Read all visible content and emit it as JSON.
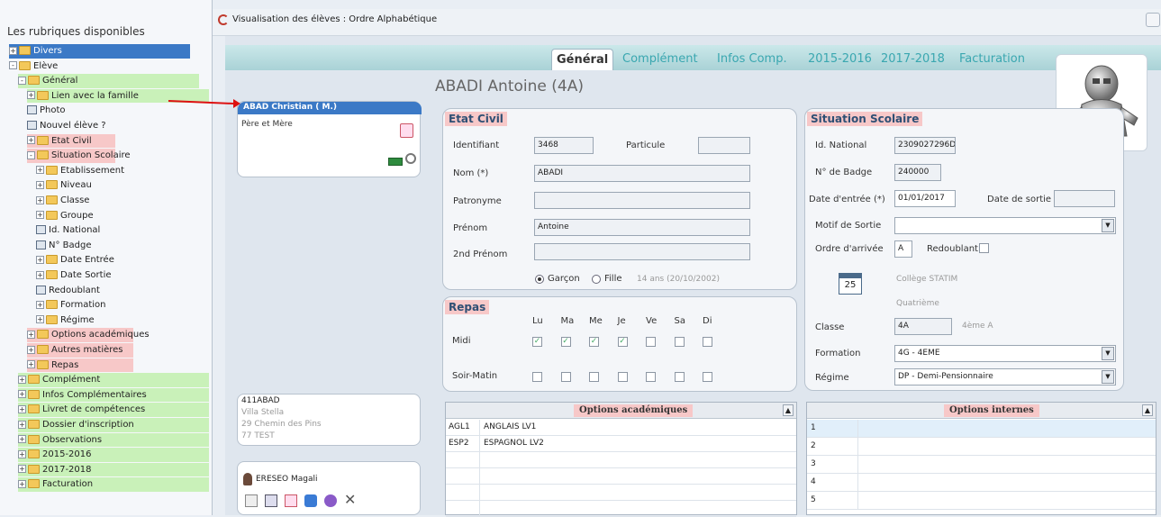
{
  "window": {
    "title": "Visualisation des élèves : Ordre Alphabétique"
  },
  "tree": {
    "header": "Les rubriques disponibles",
    "items": [
      {
        "label": "Divers",
        "exp": "+"
      },
      {
        "label": "Elève",
        "exp": "-"
      },
      {
        "label": "Général",
        "exp": "-"
      },
      {
        "label": "Lien avec la famille",
        "exp": "+"
      },
      {
        "label": "Photo",
        "exp": ""
      },
      {
        "label": "Nouvel élève ?",
        "exp": ""
      },
      {
        "label": "Etat Civil",
        "exp": "+"
      },
      {
        "label": "Situation Scolaire",
        "exp": "-"
      },
      {
        "label": "Etablissement",
        "exp": "+"
      },
      {
        "label": "Niveau",
        "exp": "+"
      },
      {
        "label": "Classe",
        "exp": "+"
      },
      {
        "label": "Groupe",
        "exp": "+"
      },
      {
        "label": "Id. National",
        "exp": ""
      },
      {
        "label": "N° Badge",
        "exp": ""
      },
      {
        "label": "Date Entrée",
        "exp": "+"
      },
      {
        "label": "Date Sortie",
        "exp": "+"
      },
      {
        "label": "Redoublant",
        "exp": ""
      },
      {
        "label": "Formation",
        "exp": "+"
      },
      {
        "label": "Régime",
        "exp": "+"
      },
      {
        "label": "Options académiques",
        "exp": "+"
      },
      {
        "label": "Autres matières",
        "exp": "+"
      },
      {
        "label": "Repas",
        "exp": "+"
      },
      {
        "label": "Complément",
        "exp": "+"
      },
      {
        "label": "Infos Complémentaires",
        "exp": "+"
      },
      {
        "label": "Livret de compétences",
        "exp": "+"
      },
      {
        "label": "Dossier d'inscription",
        "exp": "+"
      },
      {
        "label": "Observations",
        "exp": "+"
      },
      {
        "label": "2015-2016",
        "exp": "+"
      },
      {
        "label": "2017-2018",
        "exp": "+"
      },
      {
        "label": "Facturation",
        "exp": "+"
      }
    ]
  },
  "tabs": [
    "Général",
    "Complément",
    "Infos Comp.",
    "2015-2016",
    "2017-2018",
    "Facturation"
  ],
  "student": {
    "heading": "ABADI Antoine (4A)"
  },
  "family_card": {
    "title": "ABAD Christian  ( M.)",
    "relation": "Père et Mère"
  },
  "address_card": {
    "code": "411ABAD",
    "line1": "Villa Stella",
    "line2": "29 Chemin des Pins",
    "line3": "77 TEST"
  },
  "contact_card": {
    "name": "ERESEO Magali"
  },
  "etat_civil": {
    "title": "Etat Civil",
    "identifiant_label": "Identifiant",
    "identifiant": "3468",
    "particule_label": "Particule",
    "particule": "",
    "nom_label": "Nom (*)",
    "nom": "ABADI",
    "patronyme_label": "Patronyme",
    "patronyme": "",
    "prenom_label": "Prénom",
    "prenom": "Antoine",
    "prenom2_label": "2nd Prénom",
    "prenom2": "",
    "garcon": "Garçon",
    "fille": "Fille",
    "age": "14 ans (20/10/2002)"
  },
  "situation": {
    "title": "Situation Scolaire",
    "idnat_label": "Id. National",
    "idnat": "2309027296D",
    "badge_label": "N° de Badge",
    "badge": "240000",
    "entree_label": "Date d'entrée (*)",
    "entree": "01/01/2017",
    "sortie_label": "Date de sortie",
    "sortie": "",
    "motif_label": "Motif de Sortie",
    "motif": "",
    "ordre_label": "Ordre d'arrivée",
    "ordre": "A",
    "redoublant_label": "Redoublant",
    "etablissement": "Collège STATIM",
    "niveau": "Quatrième",
    "calendar_day": "25",
    "classe_label": "Classe",
    "classe": "4A",
    "classe_desc": "4ème A",
    "formation_label": "Formation",
    "formation": "4G - 4EME",
    "regime_label": "Régime",
    "regime": "DP - Demi-Pensionnaire"
  },
  "repas": {
    "title": "Repas",
    "days": [
      "Lu",
      "Ma",
      "Me",
      "Je",
      "Ve",
      "Sa",
      "Di"
    ],
    "rows": [
      {
        "label": "Midi",
        "checked": [
          true,
          true,
          true,
          true,
          false,
          false,
          false
        ]
      },
      {
        "label": "Soir-Matin",
        "checked": [
          false,
          false,
          false,
          false,
          false,
          false,
          false
        ]
      }
    ]
  },
  "options_academiques": {
    "title": "Options académiques",
    "rows": [
      [
        "AGL1",
        "ANGLAIS LV1"
      ],
      [
        "ESP2",
        "ESPAGNOL LV2"
      ]
    ]
  },
  "options_internes": {
    "title": "Options internes",
    "rows": [
      "1",
      "2",
      "3",
      "4",
      "5"
    ]
  }
}
